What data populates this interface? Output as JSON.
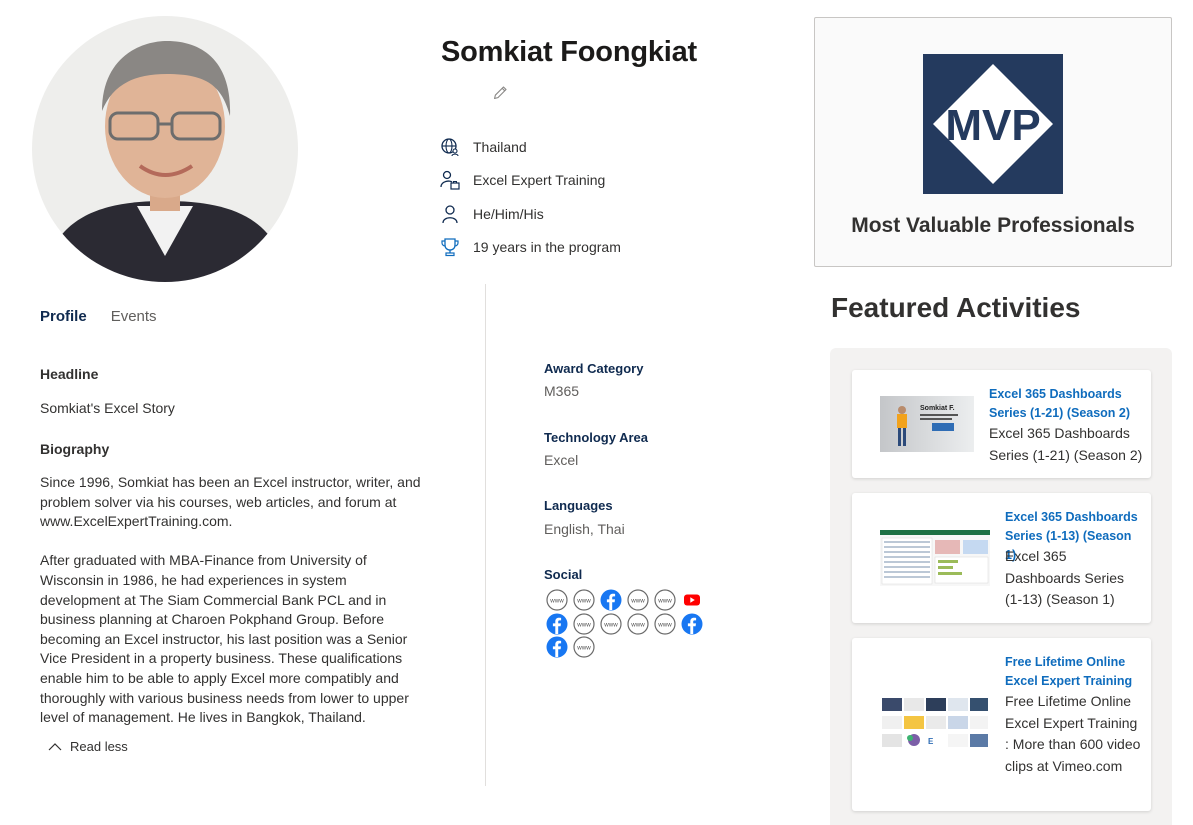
{
  "profile": {
    "name": "Somkiat Foongkiat",
    "country": "Thailand",
    "company": "Excel Expert Training",
    "pronouns": "He/Him/His",
    "tenure": "19 years in the program"
  },
  "mvp_card": {
    "logo_text": "MVP",
    "title": "Most Valuable Professionals",
    "logo_color": "#243a5e"
  },
  "tabs": [
    {
      "label": "Profile",
      "active": true
    },
    {
      "label": "Events",
      "active": false
    }
  ],
  "headline": {
    "label": "Headline",
    "value": "Somkiat's Excel Story"
  },
  "biography": {
    "label": "Biography",
    "paragraph_1": "Since 1996, Somkiat has been an Excel instructor, writer, and problem solver via his courses, web articles, and forum at www.ExcelExpertTraining.com.",
    "paragraph_2": "After graduated with MBA-Finance from University of Wisconsin in 1986, he had experiences in system development at The Siam Commercial Bank PCL and in business planning at Charoen Pokphand Group. Before becoming an Excel instructor, his last position was a Senior Vice President in a property business. These qualifications enable him to be able to apply Excel more compatibly and thoroughly with various business needs from lower to upper level of management. He lives in Bangkok, Thailand.",
    "toggle": "Read less"
  },
  "details": {
    "award_category_label": "Award Category",
    "award_category": "M365",
    "technology_area_label": "Technology Area",
    "technology_area": "Excel",
    "languages_label": "Languages",
    "languages": "English, Thai",
    "social_label": "Social"
  },
  "social_icons": [
    "www-icon",
    "www-icon",
    "facebook-icon",
    "www-icon",
    "www-icon",
    "youtube-icon",
    "facebook-icon",
    "www-icon",
    "www-icon",
    "www-icon",
    "www-icon",
    "facebook-icon",
    "facebook-icon",
    "www-icon"
  ],
  "featured": {
    "title": "Featured Activities",
    "items": [
      {
        "link": "Excel 365 Dashboards Series (1-21) (Season 2)",
        "description": "Excel 365 Dashboards Series (1-21) (Season 2)",
        "thumb_name": "Somkiat F."
      },
      {
        "link": "Excel 365 Dashboards Series (1-13) (Season 1)",
        "description": "Excel 365 Dashboards Series (1-13) (Season 1)"
      },
      {
        "link": "Free Lifetime Online Excel Expert Training",
        "description": "Free Lifetime Online Excel Expert Training : More than 600 video clips at Vimeo.com"
      }
    ]
  },
  "colors": {
    "accent_link": "#0f6cbd",
    "heading_navy": "#0f2a4f",
    "facebook": "#1877f2",
    "youtube": "#ff0000"
  }
}
